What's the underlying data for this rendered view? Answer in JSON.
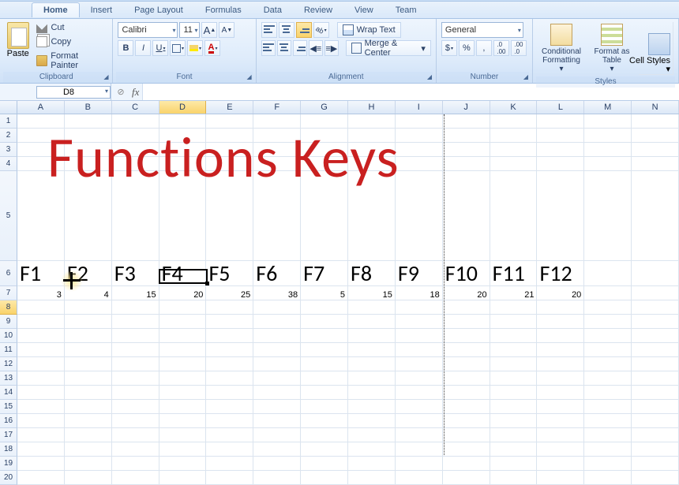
{
  "tabs": {
    "home": "Home",
    "insert": "Insert",
    "pagelayout": "Page Layout",
    "formulas": "Formulas",
    "data": "Data",
    "review": "Review",
    "view": "View",
    "team": "Team"
  },
  "clipboard": {
    "paste": "Paste",
    "cut": "Cut",
    "copy": "Copy",
    "format_painter": "Format Painter",
    "label": "Clipboard"
  },
  "font": {
    "name": "Calibri",
    "size": "11",
    "label": "Font",
    "grow": "A",
    "shrink": "A",
    "bold": "B",
    "italic": "I",
    "underline": "U"
  },
  "alignment": {
    "wrap": "Wrap Text",
    "merge": "Merge & Center",
    "label": "Alignment"
  },
  "number": {
    "format": "General",
    "label": "Number",
    "currency": "$",
    "percent": "%",
    "comma": ",",
    "inc": ".0→",
    "dec": "→.0"
  },
  "styles": {
    "cond": "Conditional Formatting",
    "cond_dd": "▾",
    "table": "Format as Table",
    "table_dd": "▾",
    "cell": "Cell Styles",
    "cell_dd": "▾",
    "label": "Styles"
  },
  "namebox": "D8",
  "fx": "fx",
  "columns": [
    "A",
    "B",
    "C",
    "D",
    "E",
    "F",
    "G",
    "H",
    "I",
    "J",
    "K",
    "L",
    "M",
    "N"
  ],
  "rows": [
    "1",
    "2",
    "3",
    "4",
    "5",
    "6",
    "7",
    "8",
    "9",
    "10",
    "11",
    "12",
    "13",
    "14",
    "15",
    "16",
    "17",
    "18",
    "19",
    "20"
  ],
  "title_text": "Functions Keys",
  "fkeys": [
    "F1",
    "F2",
    "F3",
    "F4",
    "F5",
    "F6",
    "F7",
    "F8",
    "F9",
    "F10",
    "F11",
    "F12"
  ],
  "values": [
    "3",
    "4",
    "15",
    "20",
    "25",
    "38",
    "5",
    "15",
    "18",
    "20",
    "21",
    "20"
  ],
  "selected_cell": "D8",
  "chart_data": {
    "type": "table",
    "title": "Functions Keys",
    "categories": [
      "F1",
      "F2",
      "F3",
      "F4",
      "F5",
      "F6",
      "F7",
      "F8",
      "F9",
      "F10",
      "F11",
      "F12"
    ],
    "values": [
      3,
      4,
      15,
      20,
      25,
      38,
      5,
      15,
      18,
      20,
      21,
      20
    ]
  }
}
